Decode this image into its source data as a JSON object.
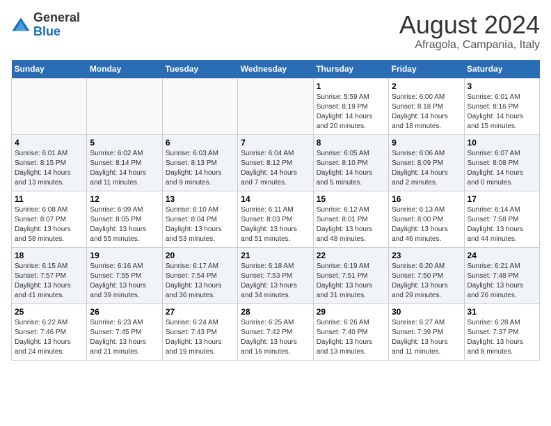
{
  "logo": {
    "general": "General",
    "blue": "Blue"
  },
  "title": "August 2024",
  "subtitle": "Afragola, Campania, Italy",
  "days_of_week": [
    "Sunday",
    "Monday",
    "Tuesday",
    "Wednesday",
    "Thursday",
    "Friday",
    "Saturday"
  ],
  "weeks": [
    [
      {
        "day": "",
        "info": ""
      },
      {
        "day": "",
        "info": ""
      },
      {
        "day": "",
        "info": ""
      },
      {
        "day": "",
        "info": ""
      },
      {
        "day": "1",
        "info": "Sunrise: 5:59 AM\nSunset: 8:19 PM\nDaylight: 14 hours and 20 minutes."
      },
      {
        "day": "2",
        "info": "Sunrise: 6:00 AM\nSunset: 8:18 PM\nDaylight: 14 hours and 18 minutes."
      },
      {
        "day": "3",
        "info": "Sunrise: 6:01 AM\nSunset: 8:16 PM\nDaylight: 14 hours and 15 minutes."
      }
    ],
    [
      {
        "day": "4",
        "info": "Sunrise: 6:01 AM\nSunset: 8:15 PM\nDaylight: 14 hours and 13 minutes."
      },
      {
        "day": "5",
        "info": "Sunrise: 6:02 AM\nSunset: 8:14 PM\nDaylight: 14 hours and 11 minutes."
      },
      {
        "day": "6",
        "info": "Sunrise: 6:03 AM\nSunset: 8:13 PM\nDaylight: 14 hours and 9 minutes."
      },
      {
        "day": "7",
        "info": "Sunrise: 6:04 AM\nSunset: 8:12 PM\nDaylight: 14 hours and 7 minutes."
      },
      {
        "day": "8",
        "info": "Sunrise: 6:05 AM\nSunset: 8:10 PM\nDaylight: 14 hours and 5 minutes."
      },
      {
        "day": "9",
        "info": "Sunrise: 6:06 AM\nSunset: 8:09 PM\nDaylight: 14 hours and 2 minutes."
      },
      {
        "day": "10",
        "info": "Sunrise: 6:07 AM\nSunset: 8:08 PM\nDaylight: 14 hours and 0 minutes."
      }
    ],
    [
      {
        "day": "11",
        "info": "Sunrise: 6:08 AM\nSunset: 8:07 PM\nDaylight: 13 hours and 58 minutes."
      },
      {
        "day": "12",
        "info": "Sunrise: 6:09 AM\nSunset: 8:05 PM\nDaylight: 13 hours and 55 minutes."
      },
      {
        "day": "13",
        "info": "Sunrise: 6:10 AM\nSunset: 8:04 PM\nDaylight: 13 hours and 53 minutes."
      },
      {
        "day": "14",
        "info": "Sunrise: 6:11 AM\nSunset: 8:03 PM\nDaylight: 13 hours and 51 minutes."
      },
      {
        "day": "15",
        "info": "Sunrise: 6:12 AM\nSunset: 8:01 PM\nDaylight: 13 hours and 48 minutes."
      },
      {
        "day": "16",
        "info": "Sunrise: 6:13 AM\nSunset: 8:00 PM\nDaylight: 13 hours and 46 minutes."
      },
      {
        "day": "17",
        "info": "Sunrise: 6:14 AM\nSunset: 7:58 PM\nDaylight: 13 hours and 44 minutes."
      }
    ],
    [
      {
        "day": "18",
        "info": "Sunrise: 6:15 AM\nSunset: 7:57 PM\nDaylight: 13 hours and 41 minutes."
      },
      {
        "day": "19",
        "info": "Sunrise: 6:16 AM\nSunset: 7:55 PM\nDaylight: 13 hours and 39 minutes."
      },
      {
        "day": "20",
        "info": "Sunrise: 6:17 AM\nSunset: 7:54 PM\nDaylight: 13 hours and 36 minutes."
      },
      {
        "day": "21",
        "info": "Sunrise: 6:18 AM\nSunset: 7:53 PM\nDaylight: 13 hours and 34 minutes."
      },
      {
        "day": "22",
        "info": "Sunrise: 6:19 AM\nSunset: 7:51 PM\nDaylight: 13 hours and 31 minutes."
      },
      {
        "day": "23",
        "info": "Sunrise: 6:20 AM\nSunset: 7:50 PM\nDaylight: 13 hours and 29 minutes."
      },
      {
        "day": "24",
        "info": "Sunrise: 6:21 AM\nSunset: 7:48 PM\nDaylight: 13 hours and 26 minutes."
      }
    ],
    [
      {
        "day": "25",
        "info": "Sunrise: 6:22 AM\nSunset: 7:46 PM\nDaylight: 13 hours and 24 minutes."
      },
      {
        "day": "26",
        "info": "Sunrise: 6:23 AM\nSunset: 7:45 PM\nDaylight: 13 hours and 21 minutes."
      },
      {
        "day": "27",
        "info": "Sunrise: 6:24 AM\nSunset: 7:43 PM\nDaylight: 13 hours and 19 minutes."
      },
      {
        "day": "28",
        "info": "Sunrise: 6:25 AM\nSunset: 7:42 PM\nDaylight: 13 hours and 16 minutes."
      },
      {
        "day": "29",
        "info": "Sunrise: 6:26 AM\nSunset: 7:40 PM\nDaylight: 13 hours and 13 minutes."
      },
      {
        "day": "30",
        "info": "Sunrise: 6:27 AM\nSunset: 7:39 PM\nDaylight: 13 hours and 11 minutes."
      },
      {
        "day": "31",
        "info": "Sunrise: 6:28 AM\nSunset: 7:37 PM\nDaylight: 13 hours and 8 minutes."
      }
    ]
  ]
}
